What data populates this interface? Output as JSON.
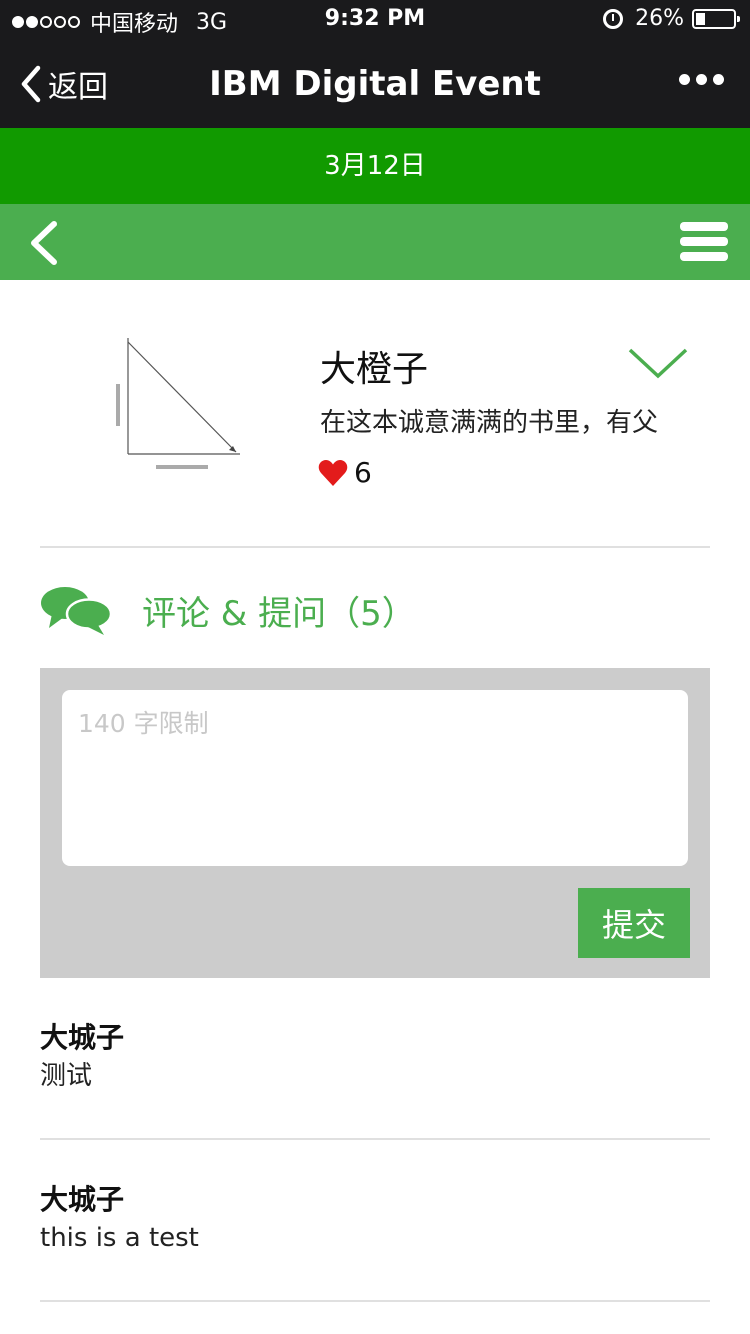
{
  "status_bar": {
    "carrier": "中国移动",
    "network": "3G",
    "time": "9:32 PM",
    "battery": "26%",
    "battery_level": 0.26
  },
  "navbar": {
    "back_label": "返回",
    "title": "IBM Digital Event"
  },
  "date_bar": {
    "date": "3月12日"
  },
  "event": {
    "title": "大橙子",
    "description": "在这本诚意满满的书里，有父",
    "likes": "6"
  },
  "comments_section": {
    "title": "评论 & 提问（5）",
    "input_placeholder": "140 字限制",
    "submit_label": "提交"
  },
  "comments": [
    {
      "author": "大城子",
      "text": "测试"
    },
    {
      "author": "大城子",
      "text": "this is a test"
    }
  ],
  "colors": {
    "dark_bar": "#1a1a1c",
    "date_bar_green": "#119a00",
    "accent_green": "#4bae4f",
    "heart_red": "#e31b1b",
    "input_area_gray": "#cccccc"
  }
}
